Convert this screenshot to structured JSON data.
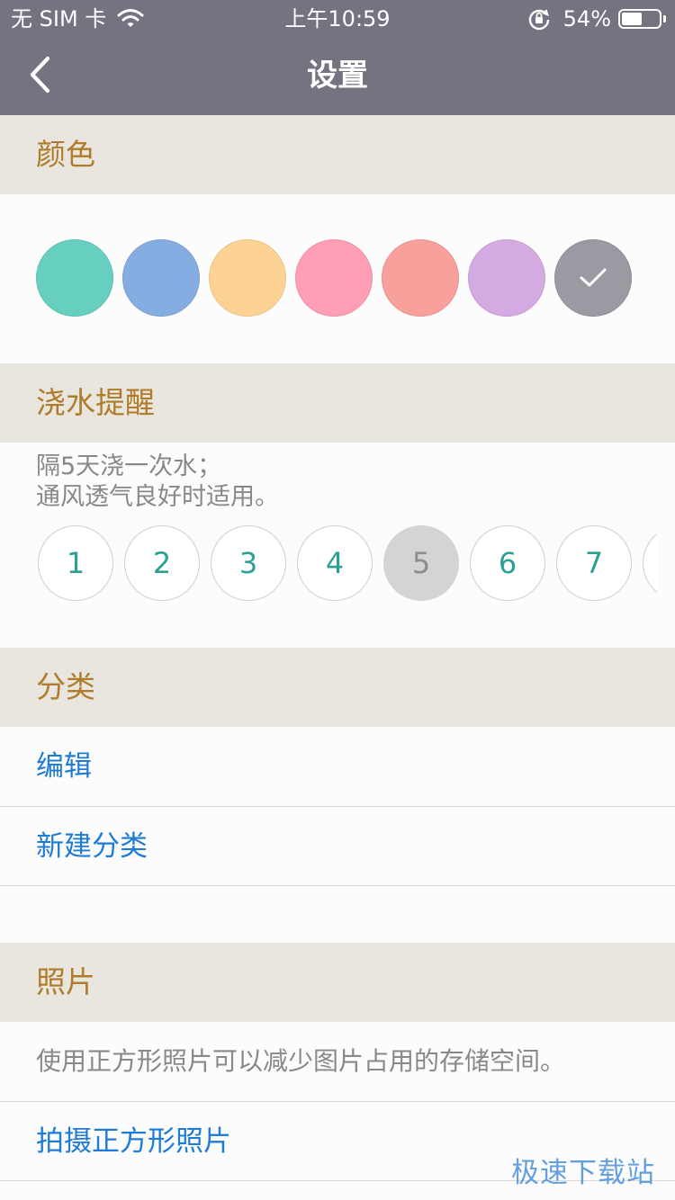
{
  "status_bar": {
    "carrier": "无 SIM 卡",
    "time": "上午10:59",
    "battery": "54%",
    "battery_level": 0.54,
    "icons": [
      "wifi-icon",
      "rotation-lock-icon",
      "battery-icon"
    ]
  },
  "nav": {
    "title": "设置",
    "back_icon": "chevron-left-icon"
  },
  "color_section": {
    "header": "颜色",
    "swatches": [
      "#66cfc0",
      "#86ade1",
      "#fdd394",
      "#ff9eb4",
      "#f8a09c",
      "#d4aae2",
      "#9a9aa3"
    ],
    "selected_index": 6
  },
  "water_section": {
    "header": "浇水提醒",
    "desc_line1": "隔5天浇一次水；",
    "desc_line2": "通风透气良好时适用。",
    "days": [
      "1",
      "2",
      "3",
      "4",
      "5",
      "6",
      "7"
    ],
    "selected_day": "5"
  },
  "category_section": {
    "header": "分类",
    "edit_label": "编辑",
    "new_label": "新建分类"
  },
  "photo_section": {
    "header": "照片",
    "info": "使用正方形照片可以减少图片占用的存储空间。",
    "take_square": "拍摄正方形照片"
  },
  "watermark": "极速下载站",
  "colors": {
    "nav_bg": "#74737f",
    "section_bg": "#e8e6df",
    "section_text": "#b07c2a",
    "link": "#1e7bd6",
    "day_text": "#2aa193"
  }
}
